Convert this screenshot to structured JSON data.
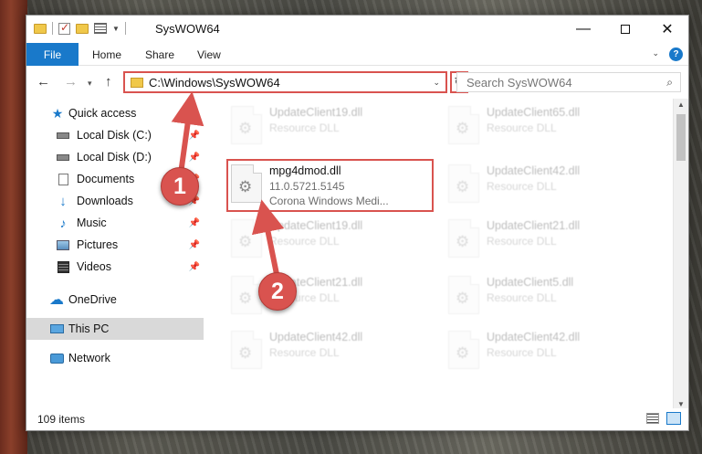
{
  "window": {
    "title": "SysWOW64",
    "controls": {
      "minimize": "—",
      "close": "✕"
    }
  },
  "ribbon": {
    "tabs": [
      {
        "label": "File"
      },
      {
        "label": "Home"
      },
      {
        "label": "Share"
      },
      {
        "label": "View"
      }
    ],
    "expand_icon": "chevron-down-icon",
    "help_label": "?"
  },
  "navigation": {
    "back": "←",
    "forward": "→",
    "recent": "▾",
    "up": "↑",
    "address": "C:\\Windows\\SysWOW64",
    "refresh": "↻",
    "search_placeholder": "Search SysWOW64"
  },
  "sidebar": {
    "items": [
      {
        "label": "Quick access",
        "icon": "star-icon",
        "pinned": false
      },
      {
        "label": "Local Disk (C:)",
        "icon": "drive-icon",
        "pinned": true
      },
      {
        "label": "Local Disk (D:)",
        "icon": "drive-icon",
        "pinned": true
      },
      {
        "label": "Documents",
        "icon": "documents-icon",
        "pinned": true
      },
      {
        "label": "Downloads",
        "icon": "download-icon",
        "pinned": true
      },
      {
        "label": "Music",
        "icon": "music-icon",
        "pinned": true
      },
      {
        "label": "Pictures",
        "icon": "pictures-icon",
        "pinned": true
      },
      {
        "label": "Videos",
        "icon": "videos-icon",
        "pinned": true
      },
      {
        "label": "OneDrive",
        "icon": "cloud-icon",
        "pinned": false
      },
      {
        "label": "This PC",
        "icon": "computer-icon",
        "pinned": false,
        "selected": true
      },
      {
        "label": "Network",
        "icon": "network-icon",
        "pinned": false
      }
    ]
  },
  "files": {
    "left_column": [
      {
        "name": "UpdateClient19.dll",
        "type": "Resource DLL"
      },
      {
        "name": "mpg4dmod.dll",
        "version": "11.0.5721.5145",
        "description": "Corona Windows Medi..."
      },
      {
        "name": "UpdateClient19.dll",
        "type": "Resource DLL"
      },
      {
        "name": "UpdateClient21.dll",
        "type": "Resource DLL"
      },
      {
        "name": "UpdateClient42.dll",
        "type": "Resource DLL"
      }
    ],
    "right_column": [
      {
        "name": "UpdateClient65.dll",
        "type": "Resource DLL"
      },
      {
        "name": "UpdateClient42.dll",
        "type": "Resource DLL"
      },
      {
        "name": "UpdateClient21.dll",
        "type": "Resource DLL"
      },
      {
        "name": "UpdateClient5.dll",
        "type": "Resource DLL"
      },
      {
        "name": "UpdateClient42.dll",
        "type": "Resource DLL"
      }
    ]
  },
  "status": {
    "item_count": "109 items"
  },
  "callouts": {
    "step1": "1",
    "step2": "2",
    "color": "#d9534f"
  }
}
